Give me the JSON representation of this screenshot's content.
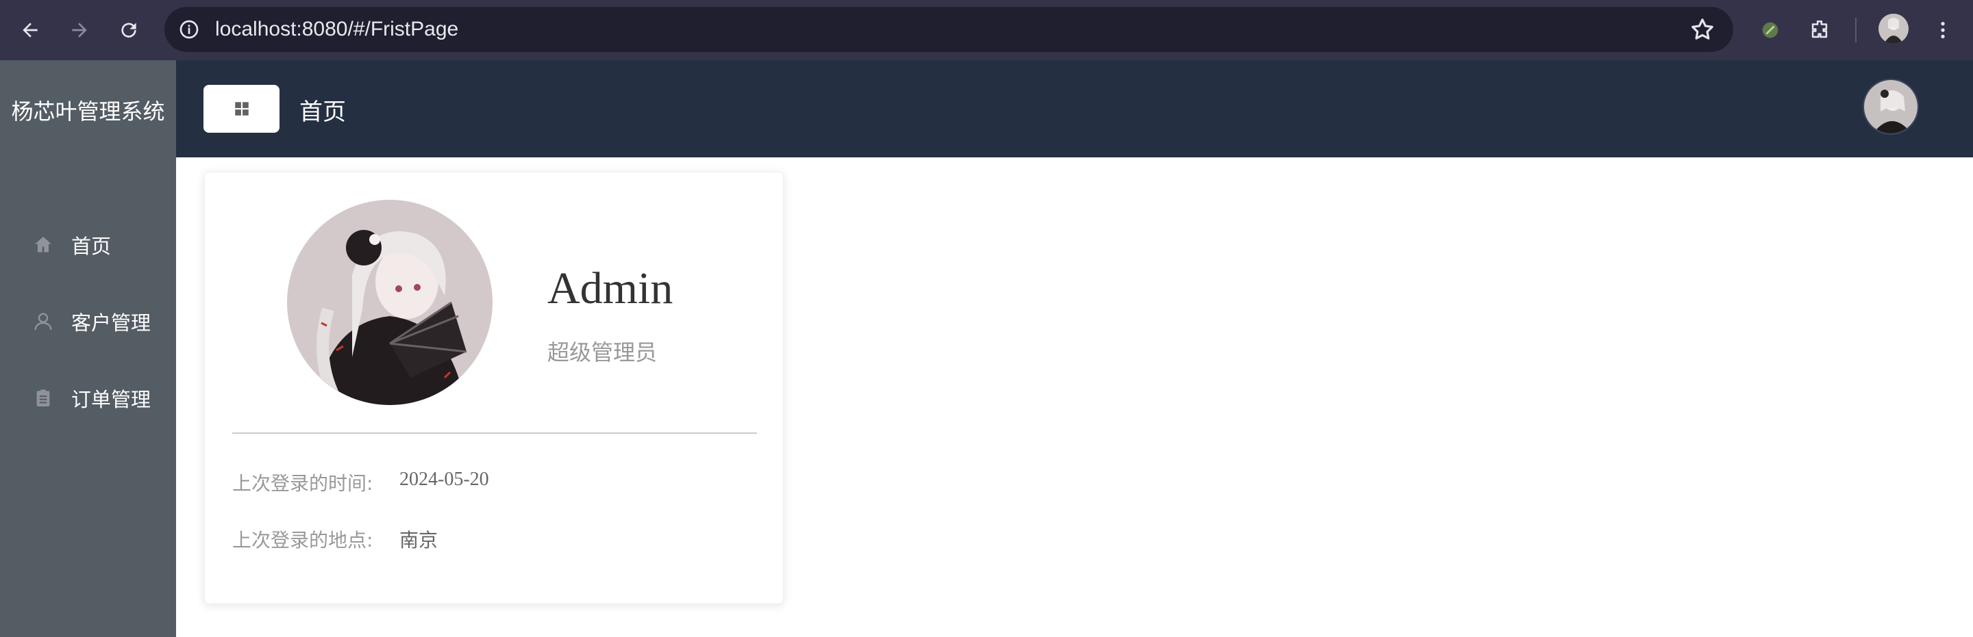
{
  "browser": {
    "url": "localhost:8080/#/FristPage"
  },
  "sidebar": {
    "brand": "杨芯叶管理系统",
    "items": [
      {
        "label": "首页",
        "icon": "home-icon"
      },
      {
        "label": "客户管理",
        "icon": "user-icon"
      },
      {
        "label": "订单管理",
        "icon": "clipboard-icon"
      }
    ]
  },
  "header": {
    "title": "首页"
  },
  "card": {
    "name": "Admin",
    "role": "超级管理员",
    "rows": [
      {
        "key": "上次登录的时间:",
        "value": "2024-05-20"
      },
      {
        "key": "上次登录的地点:",
        "value": "南京"
      }
    ]
  },
  "colors": {
    "browser_bar": "#35334a",
    "omnibox": "#201f30",
    "sidebar": "#545c64",
    "header": "#242f42",
    "text_muted": "#999999"
  }
}
